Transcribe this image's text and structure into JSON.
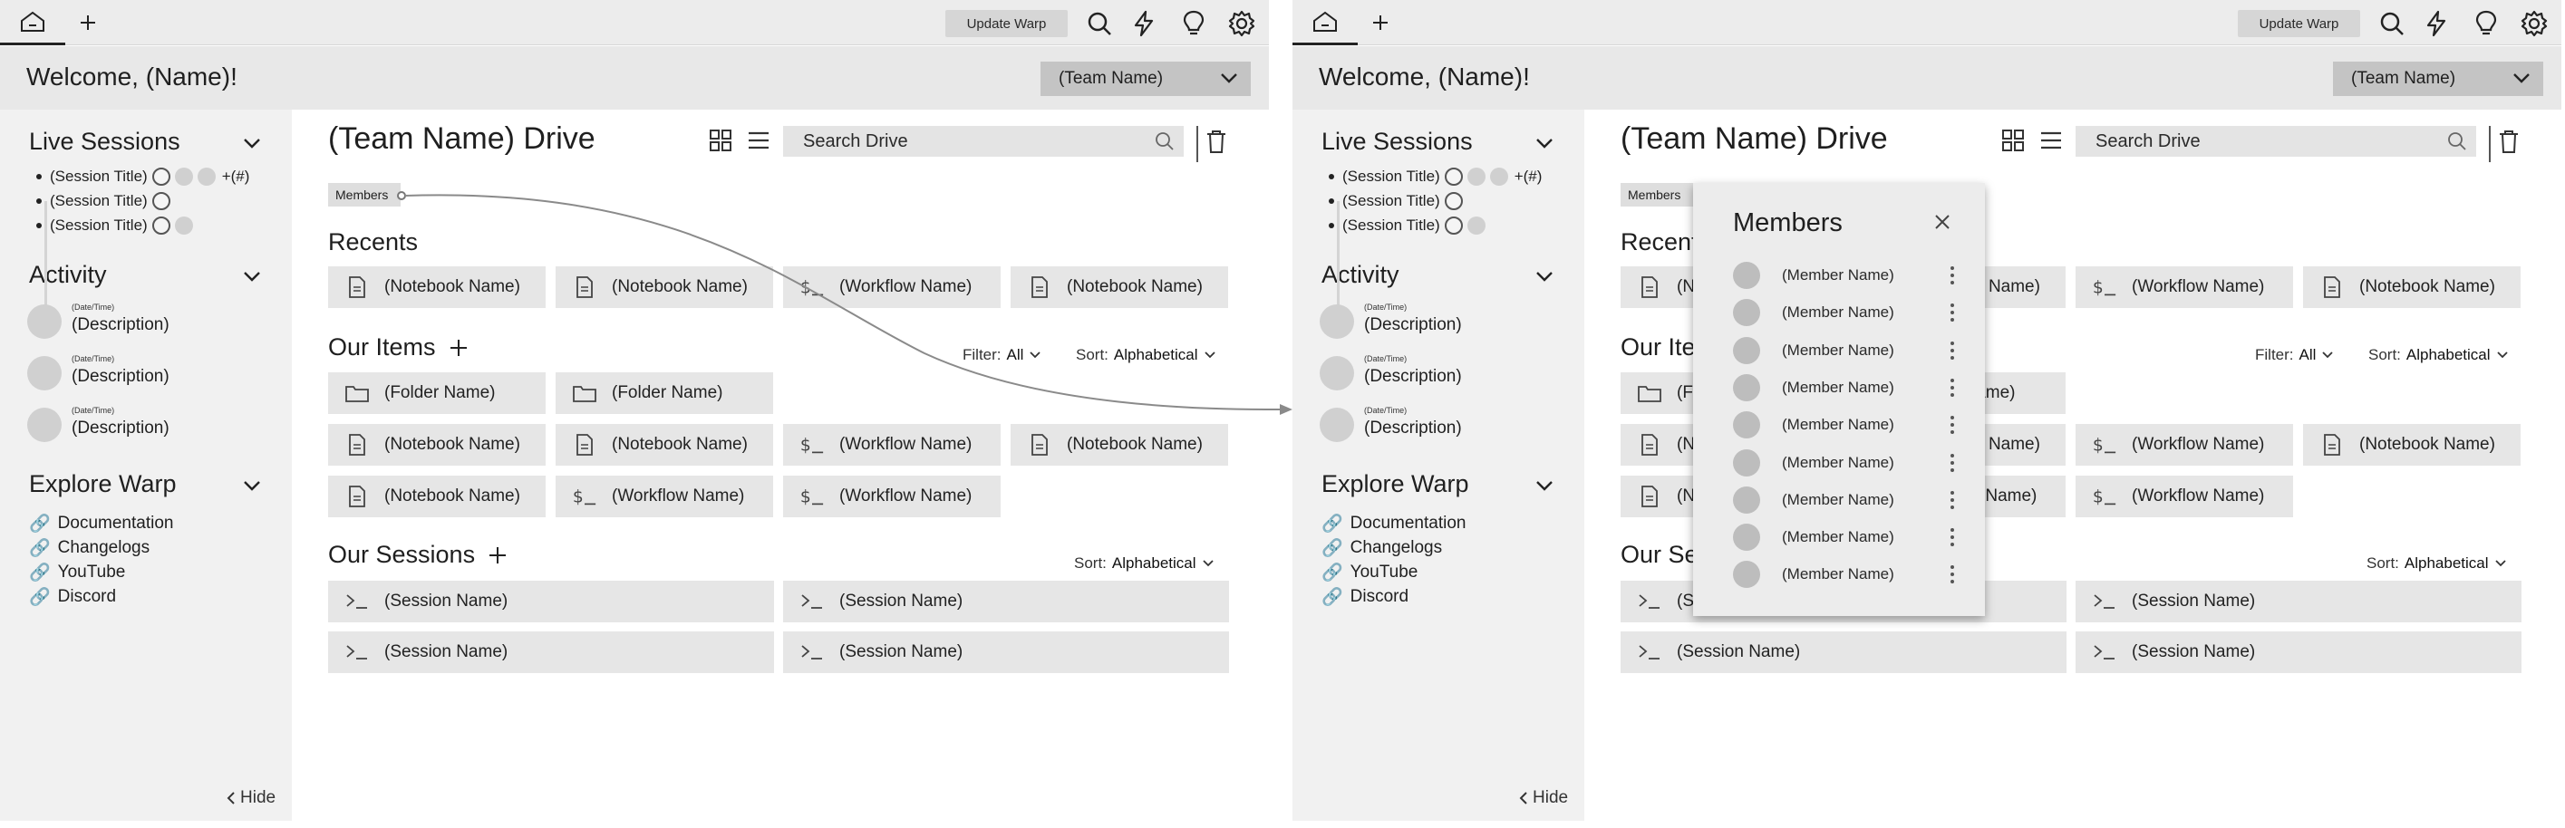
{
  "topbar": {
    "update_label": "Update Warp"
  },
  "welcome": "Welcome, (Name)!",
  "team_select": "(Team Name)",
  "live_sessions": {
    "title": "Live Sessions",
    "items": [
      {
        "label": "(Session Title)",
        "extra": "+(#)"
      },
      {
        "label": "(Session Title)"
      },
      {
        "label": "(Session Title)"
      }
    ]
  },
  "activity": {
    "title": "Activity",
    "items": [
      {
        "date": "(Date/Time)",
        "desc": "(Description)"
      },
      {
        "date": "(Date/Time)",
        "desc": "(Description)"
      },
      {
        "date": "(Date/Time)",
        "desc": "(Description)"
      }
    ]
  },
  "explore": {
    "title": "Explore Warp",
    "links": [
      "Documentation",
      "Changelogs",
      "YouTube",
      "Discord"
    ]
  },
  "hide_label": "Hide",
  "drive": {
    "title": "(Team Name) Drive",
    "search_placeholder": "Search Drive",
    "members_chip": "Members"
  },
  "recents": {
    "title": "Recents",
    "items": [
      {
        "label": "(Notebook Name)",
        "icon": "notebook-icon"
      },
      {
        "label": "(Notebook Name)",
        "icon": "notebook-icon"
      },
      {
        "label": "(Workflow Name)",
        "icon": "workflow-icon"
      },
      {
        "label": "(Notebook Name)",
        "icon": "notebook-icon"
      }
    ]
  },
  "our_items": {
    "title": "Our Items",
    "filter_label": "Filter:",
    "filter_value": "All",
    "sort_label": "Sort:",
    "sort_value": "Alphabetical",
    "folders": [
      "(Folder Name)",
      "(Folder Name)"
    ],
    "row1": [
      {
        "label": "(Notebook Name)",
        "icon": "notebook-icon"
      },
      {
        "label": "(Notebook Name)",
        "icon": "notebook-icon"
      },
      {
        "label": "(Workflow Name)",
        "icon": "workflow-icon"
      },
      {
        "label": "(Notebook Name)",
        "icon": "notebook-icon"
      }
    ],
    "row2": [
      {
        "label": "(Notebook Name)",
        "icon": "notebook-icon"
      },
      {
        "label": "(Workflow Name)",
        "icon": "workflow-icon"
      },
      {
        "label": "(Workflow Name)",
        "icon": "workflow-icon"
      }
    ]
  },
  "our_sessions": {
    "title": "Our Sessions",
    "sort_label": "Sort:",
    "sort_value": "Alphabetical",
    "items": [
      "(Session Name)",
      "(Session Name)",
      "(Session Name)",
      "(Session Name)"
    ]
  },
  "members_panel": {
    "title": "Members",
    "members": [
      "(Member Name)",
      "(Member Name)",
      "(Member Name)",
      "(Member Name)",
      "(Member Name)",
      "(Member Name)",
      "(Member Name)",
      "(Member Name)",
      "(Member Name)"
    ]
  },
  "colors": {
    "tabbar": "#ececec",
    "welcome_bar": "#e8e8e8",
    "left_panel": "#f1f1f1",
    "card": "#e6e6e6",
    "team_select": "#c4c4c4",
    "popup": "#ececec"
  }
}
